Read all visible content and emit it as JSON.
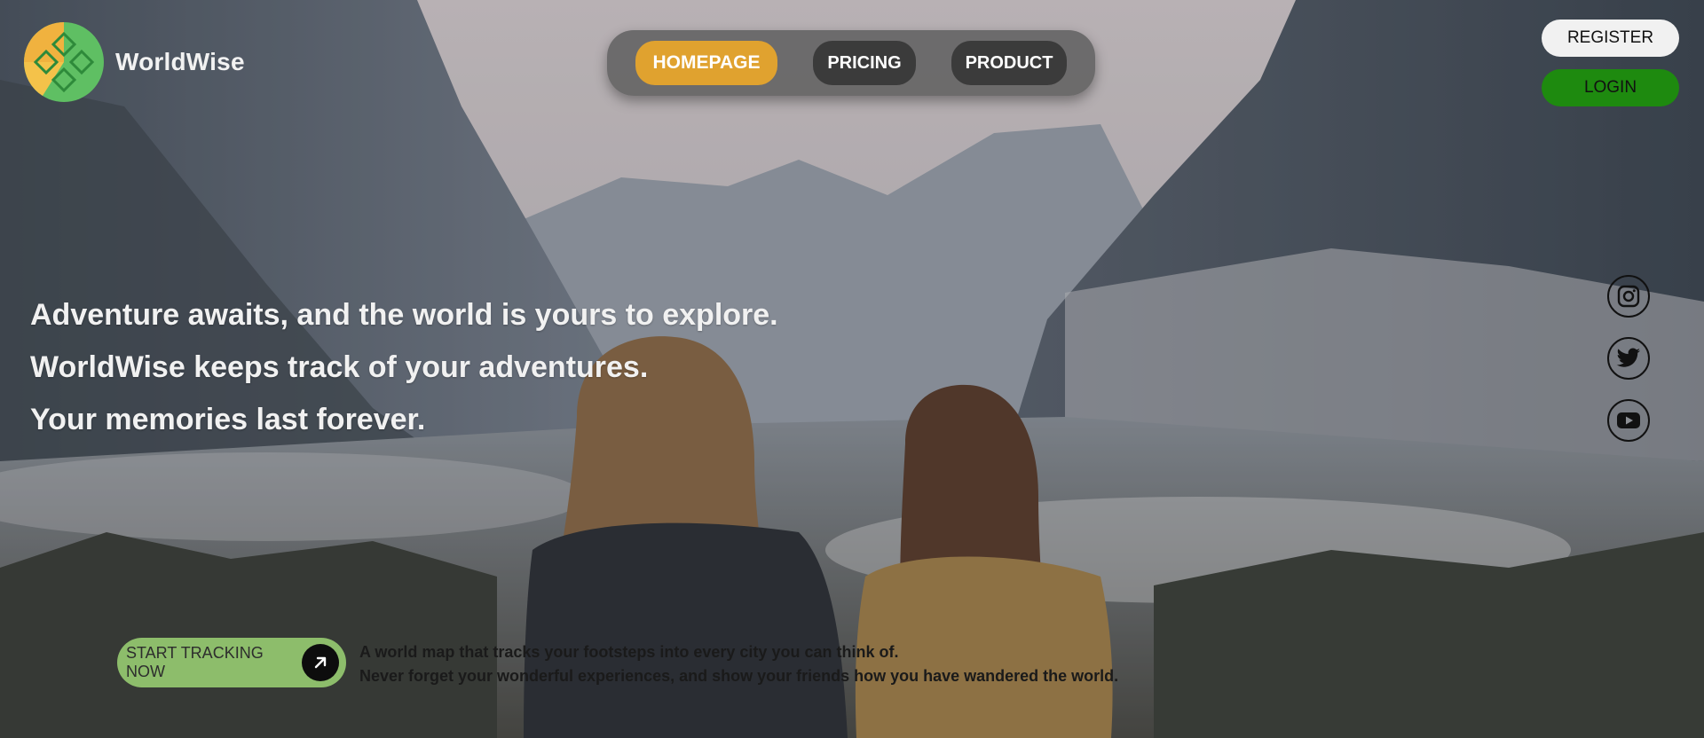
{
  "brand": {
    "name": "WorldWise",
    "logo_icon": "worldwise-logo-icon"
  },
  "nav": {
    "items": [
      {
        "label": "HOMEPAGE",
        "active": true
      },
      {
        "label": "PRICING",
        "active": false
      },
      {
        "label": "PRODUCT",
        "active": false
      }
    ]
  },
  "auth": {
    "register_label": "REGISTER",
    "login_label": "LOGIN"
  },
  "social": {
    "icons": [
      "instagram-icon",
      "twitter-icon",
      "youtube-icon"
    ]
  },
  "hero": {
    "lines": [
      "Adventure awaits, and the world is yours to explore.",
      "WorldWise keeps track of your adventures.",
      "Your memories last forever."
    ]
  },
  "cta": {
    "label": "START TRACKING NOW",
    "icon": "arrow-up-right-icon"
  },
  "tagline": {
    "lines": [
      "A world map that tracks your footsteps into every city you can think of.",
      "Never forget your wonderful experiences, and show your friends how you have wandered the world."
    ]
  },
  "colors": {
    "accent": "#e0a22f",
    "login": "#1e8a0f",
    "cta": "#8dbd6b",
    "nav_inactive": "#3b3b3b"
  }
}
